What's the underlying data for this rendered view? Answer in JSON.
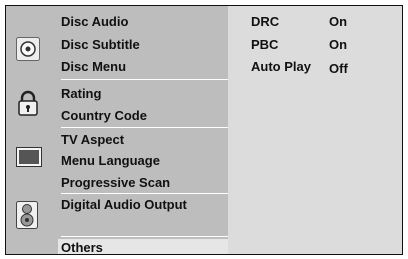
{
  "categories": [
    {
      "icon": "disc-icon",
      "items": [
        "Disc Audio",
        "Disc Subtitle",
        "Disc Menu"
      ]
    },
    {
      "icon": "padlock-icon",
      "items": [
        "Rating",
        "Country Code"
      ]
    },
    {
      "icon": "tv-screen-icon",
      "items": [
        "TV Aspect",
        "Menu Language",
        "Progressive Scan"
      ]
    },
    {
      "icon": "speaker-icon",
      "items": [
        "Digital Audio Output"
      ]
    },
    {
      "icon": "",
      "items": [
        "Others"
      ]
    }
  ],
  "options": [
    {
      "label": "DRC",
      "value": "On"
    },
    {
      "label": "PBC",
      "value": "On"
    },
    {
      "label": "Auto Play",
      "value": "Off"
    }
  ],
  "selected_item": "Others"
}
